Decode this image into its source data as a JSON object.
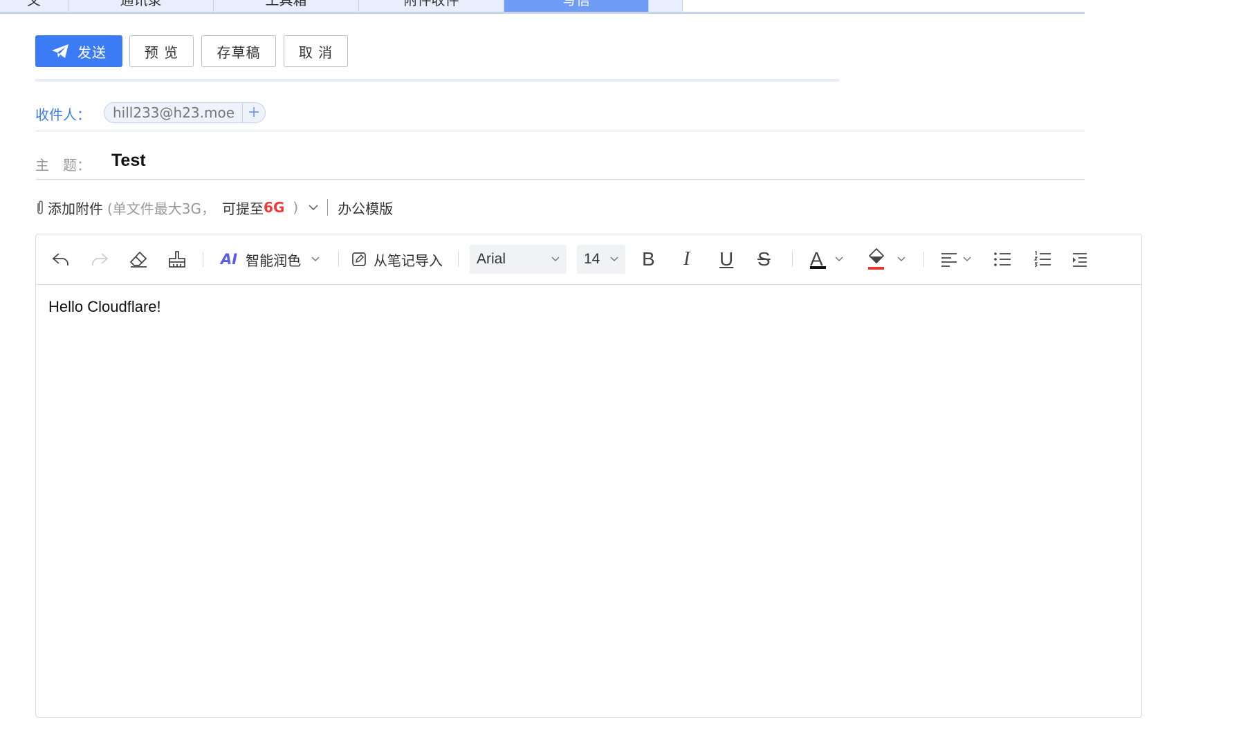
{
  "tabs": [
    {
      "label": "文"
    },
    {
      "label": "通讯录"
    },
    {
      "label": "工具箱"
    },
    {
      "label": "附件收件"
    },
    {
      "label": "写信"
    },
    {
      "label": ""
    }
  ],
  "actions": {
    "send": "发送",
    "preview": "预 览",
    "draft": "存草稿",
    "cancel": "取 消"
  },
  "recipients": {
    "label": "收件人：",
    "items": [
      "hill233@h23.moe"
    ],
    "add_symbol": "+"
  },
  "subject": {
    "label": "主　题：",
    "value": "Test"
  },
  "attachment": {
    "add_label": "添加附件",
    "hint_prefix": "(单文件最大3G，",
    "hint_upgrade": "可提至",
    "hint_upgrade_value": "6G",
    "hint_suffix": ")",
    "template_label": "办公模版"
  },
  "toolbar": {
    "ai_label": "智能润色",
    "ai_badge": "AI",
    "import_label": "从笔记导入",
    "font_family": "Arial",
    "font_size": "14",
    "bold": "B",
    "italic": "I",
    "underline": "U",
    "strike": "S",
    "font_color_glyph": "A",
    "colors": {
      "font": "#111111",
      "highlight": "#e5392f",
      "accent": "#3b7cf6",
      "ai": "#5a5be8"
    }
  },
  "editor": {
    "body": "Hello Cloudflare!"
  }
}
